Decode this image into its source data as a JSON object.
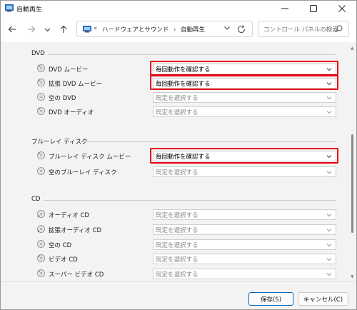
{
  "window": {
    "title": "自動再生"
  },
  "address_bar": {
    "overflow_marker": "«",
    "path": [
      "ハードウェアとサウンド",
      "自動再生"
    ],
    "separator": "›"
  },
  "search": {
    "placeholder": "コントロール パネルの検索"
  },
  "sections": [
    {
      "header": "DVD",
      "rows": [
        {
          "label": "DVD ムービー",
          "value": "毎回動作を確認する",
          "enabled": true,
          "highlighted": true
        },
        {
          "label": "拡張 DVD ムービー",
          "value": "毎回動作を確認する",
          "enabled": true,
          "highlighted": true
        },
        {
          "label": "空の DVD",
          "value": "既定を選択する",
          "enabled": false,
          "highlighted": false
        },
        {
          "label": "DVD オーディオ",
          "value": "既定を選択する",
          "enabled": false,
          "highlighted": false
        }
      ]
    },
    {
      "header": "ブルーレイ ディスク",
      "rows": [
        {
          "label": "ブルーレイ ディスク ムービー",
          "value": "毎回動作を確認する",
          "enabled": true,
          "highlighted": true
        },
        {
          "label": "空のブルーレイ ディスク",
          "value": "既定を選択する",
          "enabled": false,
          "highlighted": false
        }
      ]
    },
    {
      "header": "CD",
      "rows": [
        {
          "label": "オーディオ CD",
          "value": "既定を選択する",
          "enabled": false,
          "highlighted": false
        },
        {
          "label": "拡張オーディオ CD",
          "value": "既定を選択する",
          "enabled": false,
          "highlighted": false
        },
        {
          "label": "空の CD",
          "value": "既定を選択する",
          "enabled": false,
          "highlighted": false
        },
        {
          "label": "ビデオ CD",
          "value": "既定を選択する",
          "enabled": false,
          "highlighted": false
        },
        {
          "label": "スーパー ビデオ CD",
          "value": "既定を選択する",
          "enabled": false,
          "highlighted": false
        }
      ]
    }
  ],
  "buttons": {
    "save": "保存(S)",
    "cancel": "キャンセル(C)"
  },
  "colors": {
    "highlight": "#e60012",
    "accent": "#0067c0"
  }
}
